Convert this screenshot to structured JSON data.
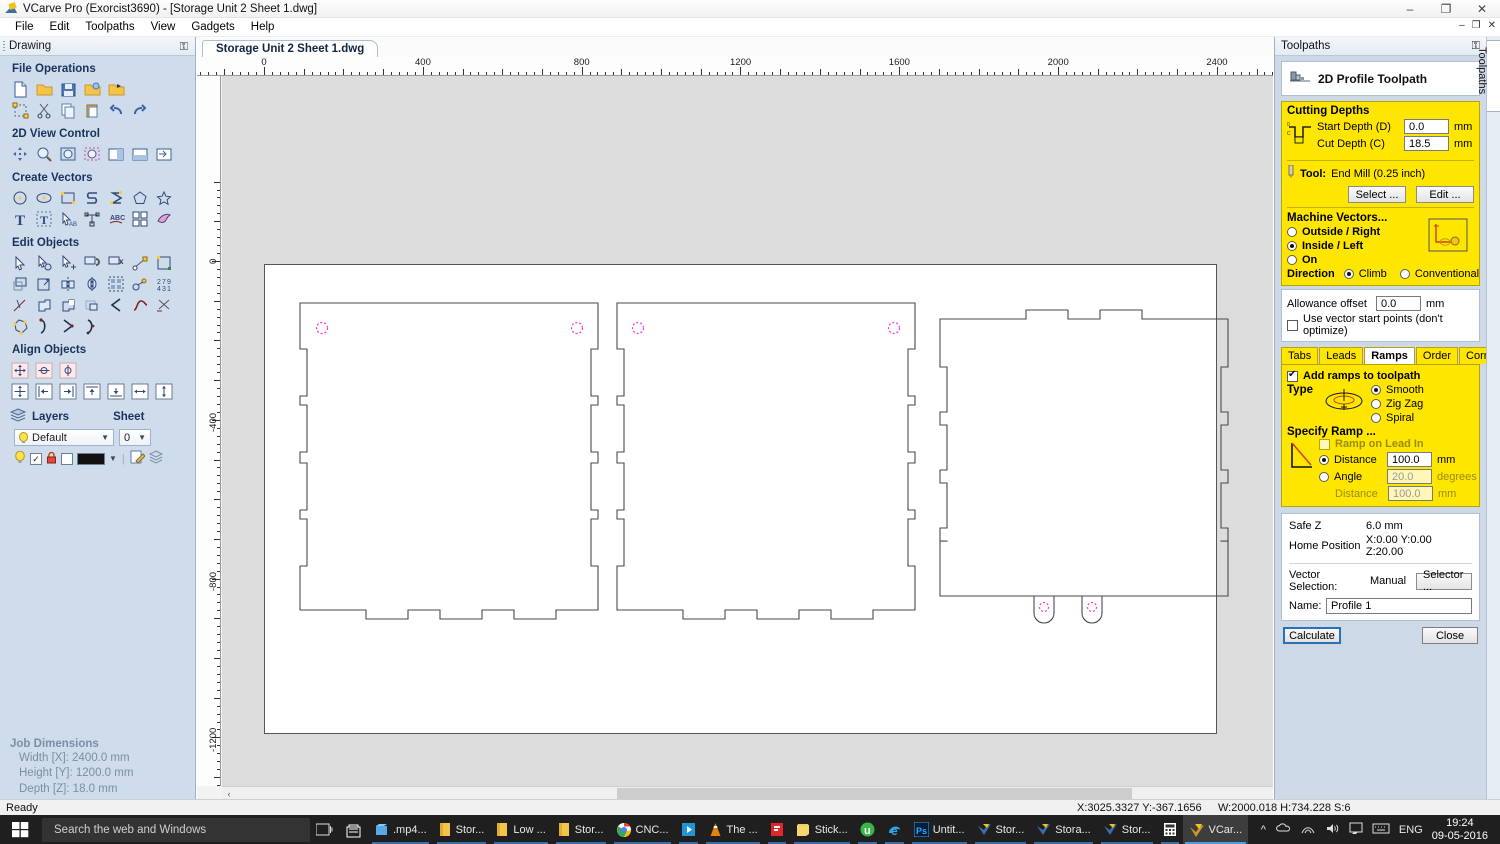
{
  "window": {
    "title": "VCarve Pro (Exorcist3690) - [Storage Unit 2 Sheet 1.dwg]",
    "app_icon": "vcarve-logo-icon",
    "minimize": "–",
    "maximize": "❐",
    "close": "✕",
    "mdi_minimize": "–",
    "mdi_restore": "❐",
    "mdi_close": "✕"
  },
  "menu": {
    "items": [
      {
        "label": "File"
      },
      {
        "label": "Edit"
      },
      {
        "label": "Toolpaths"
      },
      {
        "label": "View"
      },
      {
        "label": "Gadgets"
      },
      {
        "label": "Help"
      }
    ]
  },
  "left_dock": {
    "header": "Drawing",
    "pin_icon": "pin-icon",
    "sections": [
      {
        "title": "File Operations",
        "rows": [
          [
            "new-file-icon",
            "open-folder-icon",
            "save-disk-icon",
            "open-recent-icon",
            "import-folder-icon"
          ],
          [
            "select-all-icon",
            "cut-scissors-icon",
            "copy-icon",
            "paste-icon",
            "undo-icon",
            "redo-icon"
          ]
        ]
      },
      {
        "title": "2D View Control",
        "rows": [
          [
            "pan-icon",
            "zoom-window-icon",
            "zoom-extents-icon",
            "zoom-selected-icon",
            "toggle-left-pane-icon",
            "toggle-bottom-pane-icon",
            "toggle-right-pane-icon"
          ]
        ]
      },
      {
        "title": "Create Vectors",
        "rows": [
          [
            "circle-icon",
            "ellipse-icon",
            "rectangle-icon",
            "polyline-icon",
            "curve-icon",
            "polygon-icon",
            "star-icon"
          ],
          [
            "text-icon",
            "text-box-icon",
            "text-select-icon",
            "text-on-curve-icon",
            "arc-text-icon",
            "array-copy-icon",
            "trace-bitmap-icon"
          ]
        ]
      },
      {
        "title": "Edit Objects",
        "rows": [
          [
            "select-arrow-icon",
            "node-edit-icon",
            "add-node-icon",
            "join-vectors-icon",
            "close-vector-icon",
            "measure-icon",
            "transform-box-icon"
          ],
          [
            "offset-icon",
            "scale-icon",
            "mirror-icon",
            "flip-icon",
            "array-grid-icon",
            "weld-icon",
            "nest-icon"
          ],
          [
            "trim-icon",
            "boolean-union-icon",
            "boolean-subtract-icon",
            "boolean-intersect-icon",
            "fillet-icon",
            "smooth-curve-icon",
            "cut-vector-icon"
          ],
          [
            "node-editor-icon",
            "curve-start-icon",
            "curve-mid-icon",
            "curve-end-icon"
          ]
        ]
      },
      {
        "title": "Align Objects",
        "rows": [
          [
            "align-center-icon",
            "align-h-center-icon",
            "align-v-center-icon"
          ],
          [
            "align-page-center-icon",
            "align-left-icon",
            "align-right-icon",
            "align-top-icon",
            "align-bottom-icon",
            "align-h-page-icon",
            "align-v-page-icon"
          ]
        ]
      }
    ],
    "layers": {
      "title": "Layers",
      "layers_icon": "layers-stack-icon",
      "sheet_title": "Sheet",
      "layer_value": "Default",
      "sheet_value": "0",
      "bulb_icon": "lightbulb-icon",
      "visible_checked": true,
      "lock_icon": "lock-icon",
      "outline_icon": "outline-swatch-icon",
      "color_swatch": "#111111",
      "edit_layer_icon": "edit-layer-icon",
      "merge_layer_icon": "merge-layers-icon"
    },
    "job_dimensions": {
      "title": "Job Dimensions",
      "width": "Width  [X]: 2400.0 mm",
      "height": "Height [Y]: 1200.0 mm",
      "depth": "Depth  [Z]: 18.0 mm"
    }
  },
  "canvas": {
    "document_tab": "Storage Unit 2 Sheet 1.dwg",
    "ruler_h_labels": [
      "0",
      "400",
      "800",
      "1200",
      "1600",
      "2000",
      "2400"
    ],
    "ruler_v_labels": [
      "0",
      "-400",
      "-800",
      "-1200"
    ],
    "scroll_left_arrow": "‹"
  },
  "toolpaths": {
    "header": "Toolpaths",
    "pin_icon": "pin-icon",
    "side_tab_label": "Toolpaths",
    "toolpath_title": "2D Profile Toolpath",
    "toolpath_icon": "end-mill-icon",
    "cutting_depths": {
      "title": "Cutting Depths",
      "depth_icon": "cut-depth-profile-icon",
      "start_depth_label": "Start Depth (D)",
      "start_depth_value": "0.0",
      "start_depth_unit": "mm",
      "cut_depth_label": "Cut Depth (C)",
      "cut_depth_value": "18.5",
      "cut_depth_unit": "mm"
    },
    "tool": {
      "tool_icon": "end-mill-tool-icon",
      "label": "Tool:",
      "value": "End Mill (0.25 inch)",
      "select_button": "Select ...",
      "edit_button": "Edit ..."
    },
    "machine_vectors": {
      "title": "Machine Vectors...",
      "options": [
        {
          "label": "Outside / Right",
          "selected": false
        },
        {
          "label": "Inside / Left",
          "selected": true
        },
        {
          "label": "On",
          "selected": false
        }
      ],
      "preview_icon": "machine-vectors-preview-icon",
      "direction_label": "Direction",
      "directions": [
        {
          "label": "Climb",
          "selected": true
        },
        {
          "label": "Conventional",
          "selected": false
        }
      ]
    },
    "allowance": {
      "label": "Allowance offset",
      "value": "0.0",
      "unit": "mm",
      "start_points_label": "Use vector start points (don't optimize)",
      "start_points_checked": false
    },
    "tabs": [
      {
        "label": "Tabs",
        "active": false
      },
      {
        "label": "Leads",
        "active": false
      },
      {
        "label": "Ramps",
        "active": true
      },
      {
        "label": "Order",
        "active": false
      },
      {
        "label": "Corners",
        "active": false
      }
    ],
    "ramps": {
      "add_ramps_label": "Add ramps to toolpath",
      "add_ramps_checked": true,
      "type_label": "Type",
      "type_icon": "ramp-spiral-icon",
      "types": [
        {
          "label": "Smooth",
          "selected": true
        },
        {
          "label": "Zig Zag",
          "selected": false
        },
        {
          "label": "Spiral",
          "selected": false
        }
      ],
      "specify_label": "Specify Ramp ...",
      "specify_icon": "ramp-lead-icon",
      "lead_in_label": "Ramp on Lead In",
      "lead_in_checked": false,
      "distance_label": "Distance",
      "distance_selected": true,
      "distance_value": "100.0",
      "distance_unit": "mm",
      "angle_label": "Angle",
      "angle_selected": false,
      "angle_value": "20.0",
      "angle_unit": "degrees",
      "distance2_label": "Distance",
      "distance2_value": "100.0",
      "distance2_unit": "mm"
    },
    "position": {
      "safe_z_label": "Safe Z",
      "safe_z_value": "6.0 mm",
      "home_label": "Home Position",
      "home_value": "X:0.00 Y:0.00 Z:20.00",
      "vector_selection_label": "Vector Selection:",
      "vector_selection_value": "Manual",
      "selector_button": "Selector ...",
      "name_label": "Name:",
      "name_value": "Profile 1"
    },
    "calculate_button": "Calculate",
    "close_button": "Close"
  },
  "statusbar": {
    "ready": "Ready",
    "coords": "X:3025.3327 Y:-367.1656",
    "dims": "W:2000.018  H:734.228  S:6"
  },
  "taskbar": {
    "start_icon": "windows-start-icon",
    "search_placeholder": "Search the web and Windows",
    "task_view_icon": "task-view-icon",
    "store_icon": "microsoft-store-icon",
    "items": [
      {
        "icon": "file-explorer-icon",
        "label": ".mp4..."
      },
      {
        "icon": "folder-icon",
        "label": "Stor..."
      },
      {
        "icon": "folder-icon",
        "label": "Low ..."
      },
      {
        "icon": "folder-icon",
        "label": "Stor..."
      },
      {
        "icon": "chrome-icon",
        "label": "CNC..."
      },
      {
        "icon": "media-player-icon",
        "label": ""
      },
      {
        "icon": "vlc-cone-icon",
        "label": "The ..."
      },
      {
        "icon": "flipboard-icon",
        "label": ""
      },
      {
        "icon": "sticky-notes-icon",
        "label": "Stick..."
      },
      {
        "icon": "utorrent-icon",
        "label": ""
      },
      {
        "icon": "edge-icon",
        "label": ""
      },
      {
        "icon": "photoshop-icon",
        "label": "Untit..."
      },
      {
        "icon": "vcarve-icon",
        "label": "Stor..."
      },
      {
        "icon": "vcarve-icon",
        "label": "Stora..."
      },
      {
        "icon": "vcarve-icon",
        "label": "Stor..."
      },
      {
        "icon": "calculator-icon",
        "label": ""
      },
      {
        "icon": "vcarve-icon",
        "label": "VCar...",
        "active": true
      }
    ],
    "tray": {
      "chevron_icon": "show-hidden-icons-chevron",
      "onedrive_icon": "onedrive-icon",
      "network_icon": "wifi-icon",
      "volume_icon": "volume-icon",
      "action_center_icon": "action-center-icon",
      "keyboard_icon": "keyboard-icon",
      "language": "ENG",
      "time": "19:24",
      "date": "09-05-2016"
    }
  }
}
